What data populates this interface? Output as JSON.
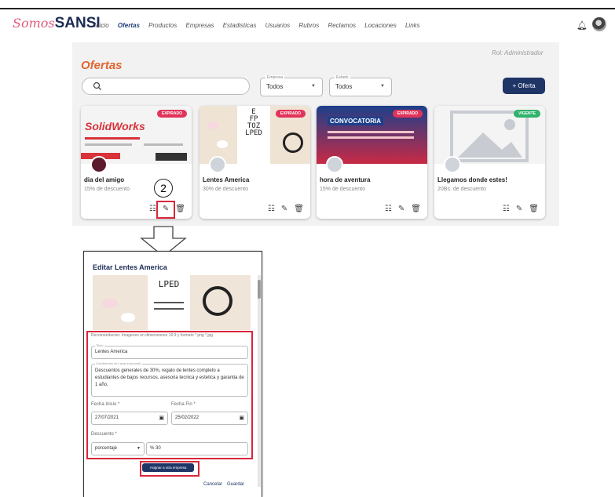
{
  "app": {
    "logo_part1": "Somos",
    "logo_part2": "SANSI"
  },
  "nav": {
    "items": [
      "Inicio",
      "Ofertas",
      "Productos",
      "Empresas",
      "Estadisticas",
      "Usuarios",
      "Rubros",
      "Reclamos",
      "Locaciones",
      "Links"
    ],
    "active": "Ofertas"
  },
  "header": {
    "role": "Rol: Administrador",
    "title": "Ofertas"
  },
  "filters": {
    "empresa_label": "Empresa",
    "empresa_value": "Todos",
    "estado_label": "Estado",
    "estado_value": "Todos",
    "add_button": "+ Oferta"
  },
  "cards": [
    {
      "name": "dia del amigo",
      "discount": "15% de descuento",
      "status": "EXPIRADO",
      "image_text": "SolidWorks"
    },
    {
      "name": "Lentes America",
      "discount": "30% de descuento",
      "status": "EXPIRADO"
    },
    {
      "name": "hora de aventura",
      "discount": "15% de descuento",
      "status": "EXPIRADO",
      "image_text": "CONVOCATORIA"
    },
    {
      "name": "Llegamos donde estes!",
      "discount": "20Bs. de descuento",
      "status": "VIGENTE"
    }
  ],
  "annotation": {
    "step": "2"
  },
  "modal": {
    "title": "Editar Lentes America",
    "recommendation": "Recomendacion: Imagenes en dimensiones 16:9 y formato *.png *.jpg",
    "name_label": "Titulo",
    "name_value": "Lentes America",
    "desc_label": "Condiciones de Largo (opcional)",
    "desc_value": "Descuentos generales de 30%, regalo de lentes completo a estudiantes de bajos recursos, asesoria tecnica y estetica y garantia de 1 año.",
    "start_label": "Fecha Inicio *",
    "start_value": "27/07/2021",
    "end_label": "Fecha Fin *",
    "end_value": "25/02/2022",
    "discount_label": "Descuento *",
    "discount_type": "porcentaje",
    "discount_value": "% 30",
    "assign_button": "Asignar a otra empresa",
    "cancel": "Cancelar",
    "save": "Guardar"
  },
  "colors": {
    "brand_navy": "#1e3566",
    "accent_orange": "#e0662f",
    "expired": "#e2345b",
    "vigente": "#2fb36b",
    "highlight_red": "#d9263a"
  }
}
